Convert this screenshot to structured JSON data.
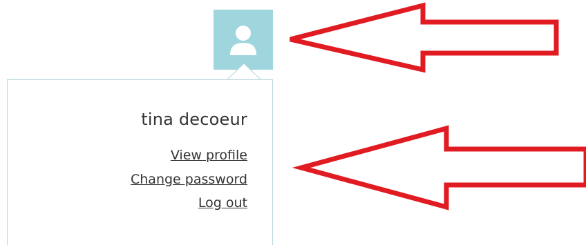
{
  "colors": {
    "avatar_bg": "#9fd5dd",
    "dropdown_border": "#b9d6da",
    "text": "#333333",
    "annotation_arrow": "#e11b22"
  },
  "avatar": {
    "icon": "user-icon"
  },
  "user_menu": {
    "user_name": "tina decoeur",
    "links": [
      {
        "label": "View profile"
      },
      {
        "label": "Change password"
      },
      {
        "label": "Log out"
      }
    ]
  },
  "annotations": {
    "icon": "arrow-left-icon",
    "count": 2
  }
}
